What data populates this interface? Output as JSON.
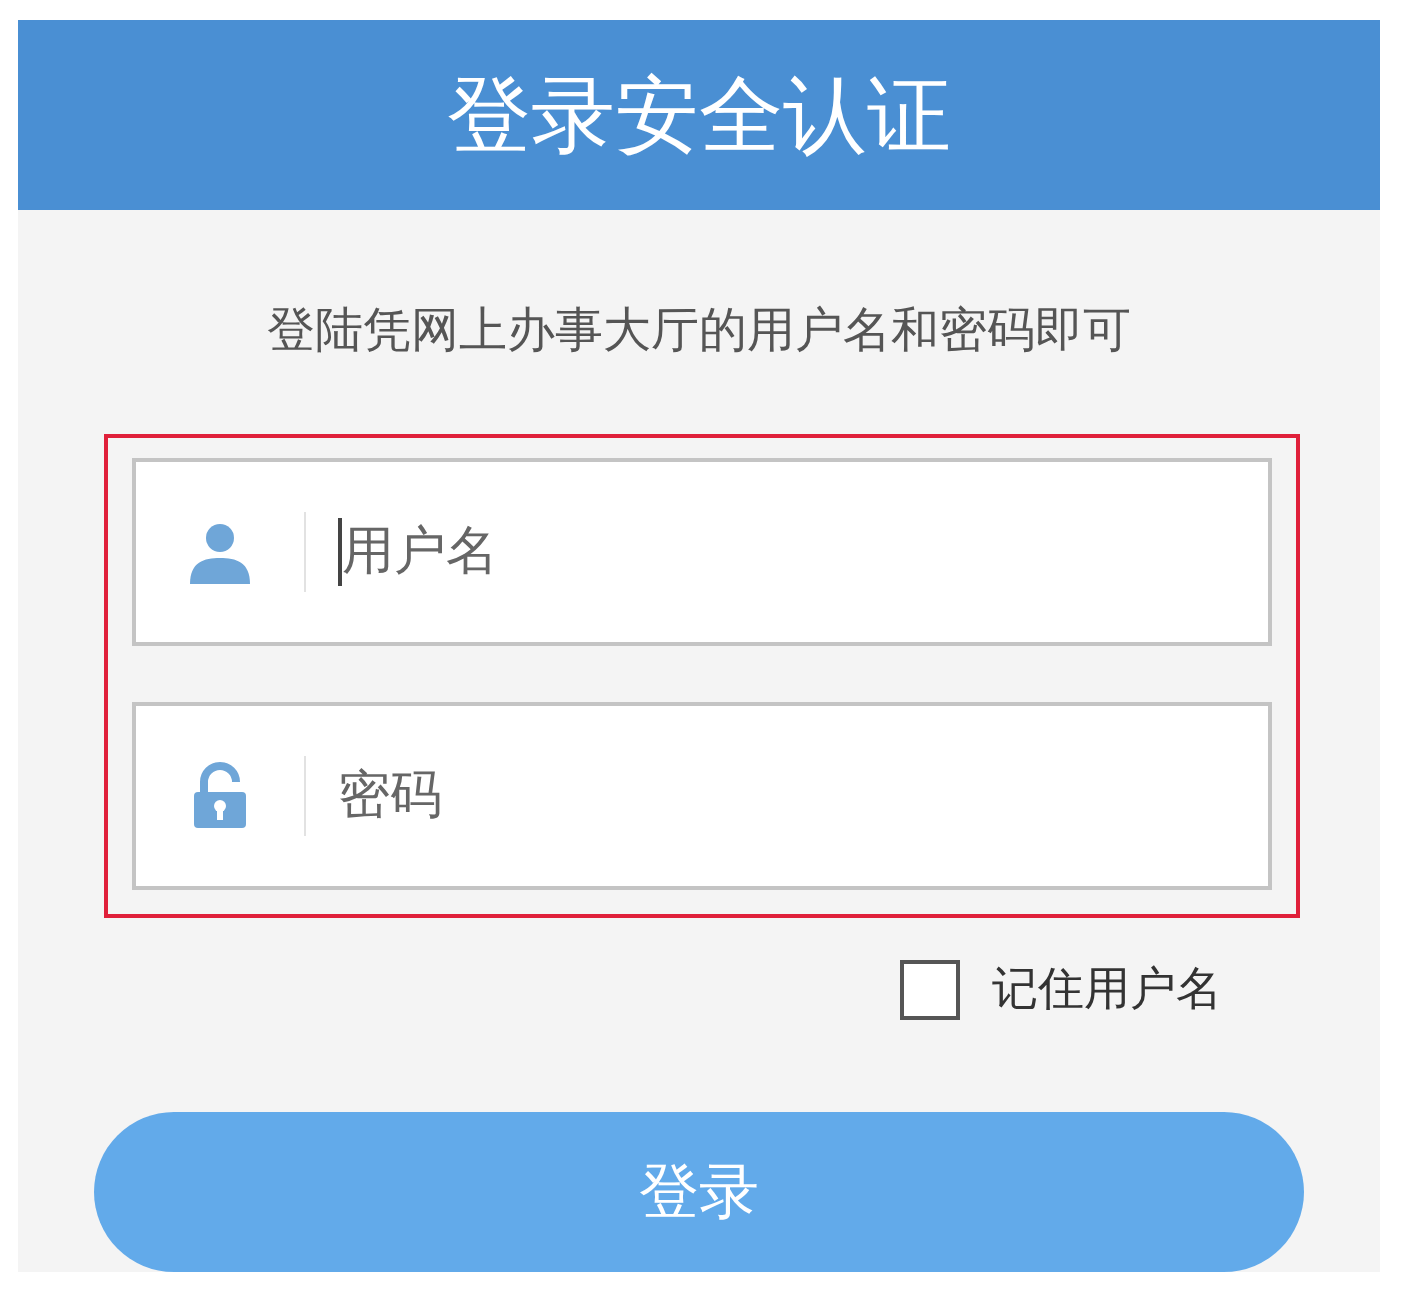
{
  "header": {
    "title": "登录安全认证"
  },
  "subtitle": "登陆凭网上办事大厅的用户名和密码即可",
  "fields": [
    {
      "kind": "user",
      "placeholder": "用户名",
      "focused": true
    },
    {
      "kind": "password",
      "placeholder": "密码",
      "focused": false
    }
  ],
  "remember": {
    "label": "记住用户名",
    "checked": false
  },
  "login_button": "登录"
}
